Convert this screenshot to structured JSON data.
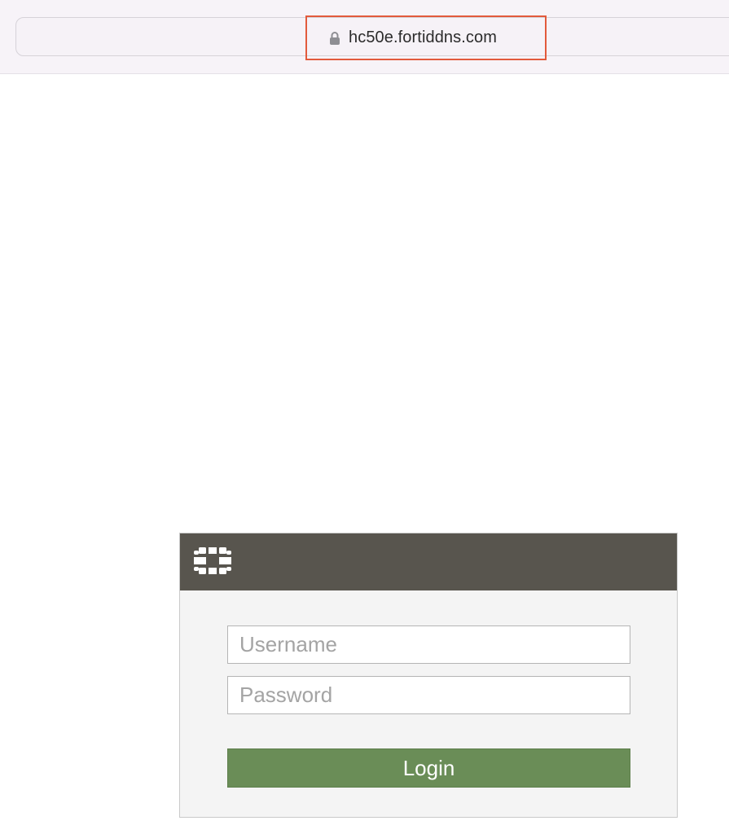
{
  "browser": {
    "url": "hc50e.fortiddns.com",
    "lock_icon": "lock-icon"
  },
  "login": {
    "logo_icon": "fortinet-logo-icon",
    "username_placeholder": "Username",
    "password_placeholder": "Password",
    "login_label": "Login"
  },
  "colors": {
    "header": "#58554e",
    "panel_bg": "#f4f4f4",
    "button": "#6a8d57",
    "highlight": "#e25a3c"
  }
}
